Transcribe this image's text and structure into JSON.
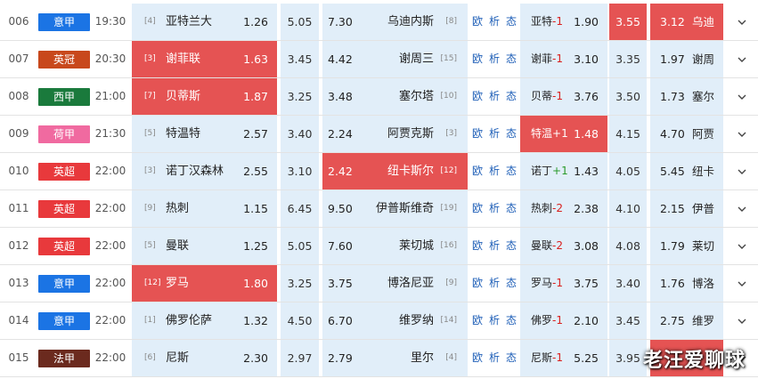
{
  "watermark": "老汪爱聊球",
  "links": [
    "欧",
    "析",
    "态"
  ],
  "expand_icon": "chevron-down-icon",
  "matches": [
    {
      "no": "006",
      "league": "意甲",
      "lc": "#1b74e4",
      "time": "19:30",
      "hr": "[4]",
      "home": "亚特兰大",
      "h": "1.26",
      "d": "5.05",
      "a": "7.30",
      "away": "乌迪内斯",
      "ar": "[8]",
      "sh": "亚特",
      "sc": "-1",
      "sca": "#d9201e",
      "h2": "1.90",
      "d2": "3.55",
      "a2": "3.12",
      "sa": "乌迪",
      "hl": [],
      "hl2": [
        "d2",
        "ac2"
      ]
    },
    {
      "no": "007",
      "league": "英冠",
      "lc": "#c8481c",
      "time": "20:30",
      "hr": "[3]",
      "home": "谢菲联",
      "h": "1.63",
      "d": "3.45",
      "a": "4.42",
      "away": "谢周三",
      "ar": "[15]",
      "sh": "谢菲",
      "sc": "-1",
      "sca": "#d9201e",
      "h2": "3.10",
      "d2": "3.35",
      "a2": "1.97",
      "sa": "谢周",
      "hl": [
        "home"
      ],
      "hl2": []
    },
    {
      "no": "008",
      "league": "西甲",
      "lc": "#1a7a3c",
      "time": "21:00",
      "hr": "[7]",
      "home": "贝蒂斯",
      "h": "1.87",
      "d": "3.25",
      "a": "3.48",
      "away": "塞尔塔",
      "ar": "[10]",
      "sh": "贝蒂",
      "sc": "-1",
      "sca": "#d9201e",
      "h2": "3.76",
      "d2": "3.50",
      "a2": "1.73",
      "sa": "塞尔",
      "hl": [
        "home"
      ],
      "hl2": []
    },
    {
      "no": "009",
      "league": "荷甲",
      "lc": "#f06aa0",
      "time": "21:30",
      "hr": "[5]",
      "home": "特温特",
      "h": "2.57",
      "d": "3.40",
      "a": "2.24",
      "away": "阿贾克斯",
      "ar": "[3]",
      "sh": "特温",
      "sc": "+1",
      "sca": "#2a9a2a",
      "h2": "1.48",
      "d2": "4.15",
      "a2": "4.70",
      "sa": "阿贾",
      "hl": [],
      "hl2": [
        "home2"
      ]
    },
    {
      "no": "010",
      "league": "英超",
      "lc": "#e8393c",
      "time": "22:00",
      "hr": "[3]",
      "home": "诺丁汉森林",
      "h": "2.55",
      "d": "3.10",
      "a": "2.42",
      "away": "纽卡斯尔",
      "ar": "[12]",
      "sh": "诺丁",
      "sc": "+1",
      "sca": "#2a9a2a",
      "h2": "1.43",
      "d2": "4.05",
      "a2": "5.45",
      "sa": "纽卡",
      "hl": [
        "away"
      ],
      "hl2": []
    },
    {
      "no": "011",
      "league": "英超",
      "lc": "#e8393c",
      "time": "22:00",
      "hr": "[9]",
      "home": "热刺",
      "h": "1.15",
      "d": "6.45",
      "a": "9.50",
      "away": "伊普斯维奇",
      "ar": "[19]",
      "sh": "热刺",
      "sc": "-2",
      "sca": "#d9201e",
      "h2": "2.38",
      "d2": "4.10",
      "a2": "2.15",
      "sa": "伊普",
      "hl": [],
      "hl2": []
    },
    {
      "no": "012",
      "league": "英超",
      "lc": "#e8393c",
      "time": "22:00",
      "hr": "[5]",
      "home": "曼联",
      "h": "1.25",
      "d": "5.05",
      "a": "7.60",
      "away": "莱切城",
      "ar": "[16]",
      "sh": "曼联",
      "sc": "-2",
      "sca": "#d9201e",
      "h2": "3.08",
      "d2": "4.08",
      "a2": "1.79",
      "sa": "莱切",
      "hl": [],
      "hl2": []
    },
    {
      "no": "013",
      "league": "意甲",
      "lc": "#1b74e4",
      "time": "22:00",
      "hr": "[12]",
      "home": "罗马",
      "h": "1.80",
      "d": "3.25",
      "a": "3.75",
      "away": "博洛尼亚",
      "ar": "[9]",
      "sh": "罗马",
      "sc": "-1",
      "sca": "#d9201e",
      "h2": "3.75",
      "d2": "3.40",
      "a2": "1.76",
      "sa": "博洛",
      "hl": [
        "home"
      ],
      "hl2": []
    },
    {
      "no": "014",
      "league": "意甲",
      "lc": "#1b74e4",
      "time": "22:00",
      "hr": "[1]",
      "home": "佛罗伦萨",
      "h": "1.32",
      "d": "4.50",
      "a": "6.70",
      "away": "维罗纳",
      "ar": "[14]",
      "sh": "佛罗",
      "sc": "-1",
      "sca": "#d9201e",
      "h2": "2.10",
      "d2": "3.45",
      "a2": "2.75",
      "sa": "维罗",
      "hl": [],
      "hl2": []
    },
    {
      "no": "015",
      "league": "法甲",
      "lc": "#6b2a1e",
      "time": "22:00",
      "hr": "[6]",
      "home": "尼斯",
      "h": "2.30",
      "d": "2.97",
      "a": "2.79",
      "away": "里尔",
      "ar": "[4]",
      "sh": "尼斯",
      "sc": "-1",
      "sca": "#d9201e",
      "h2": "5.25",
      "d2": "3.95",
      "a2": "",
      "sa": "",
      "hl": [],
      "hl2": [
        "ac2"
      ]
    }
  ]
}
